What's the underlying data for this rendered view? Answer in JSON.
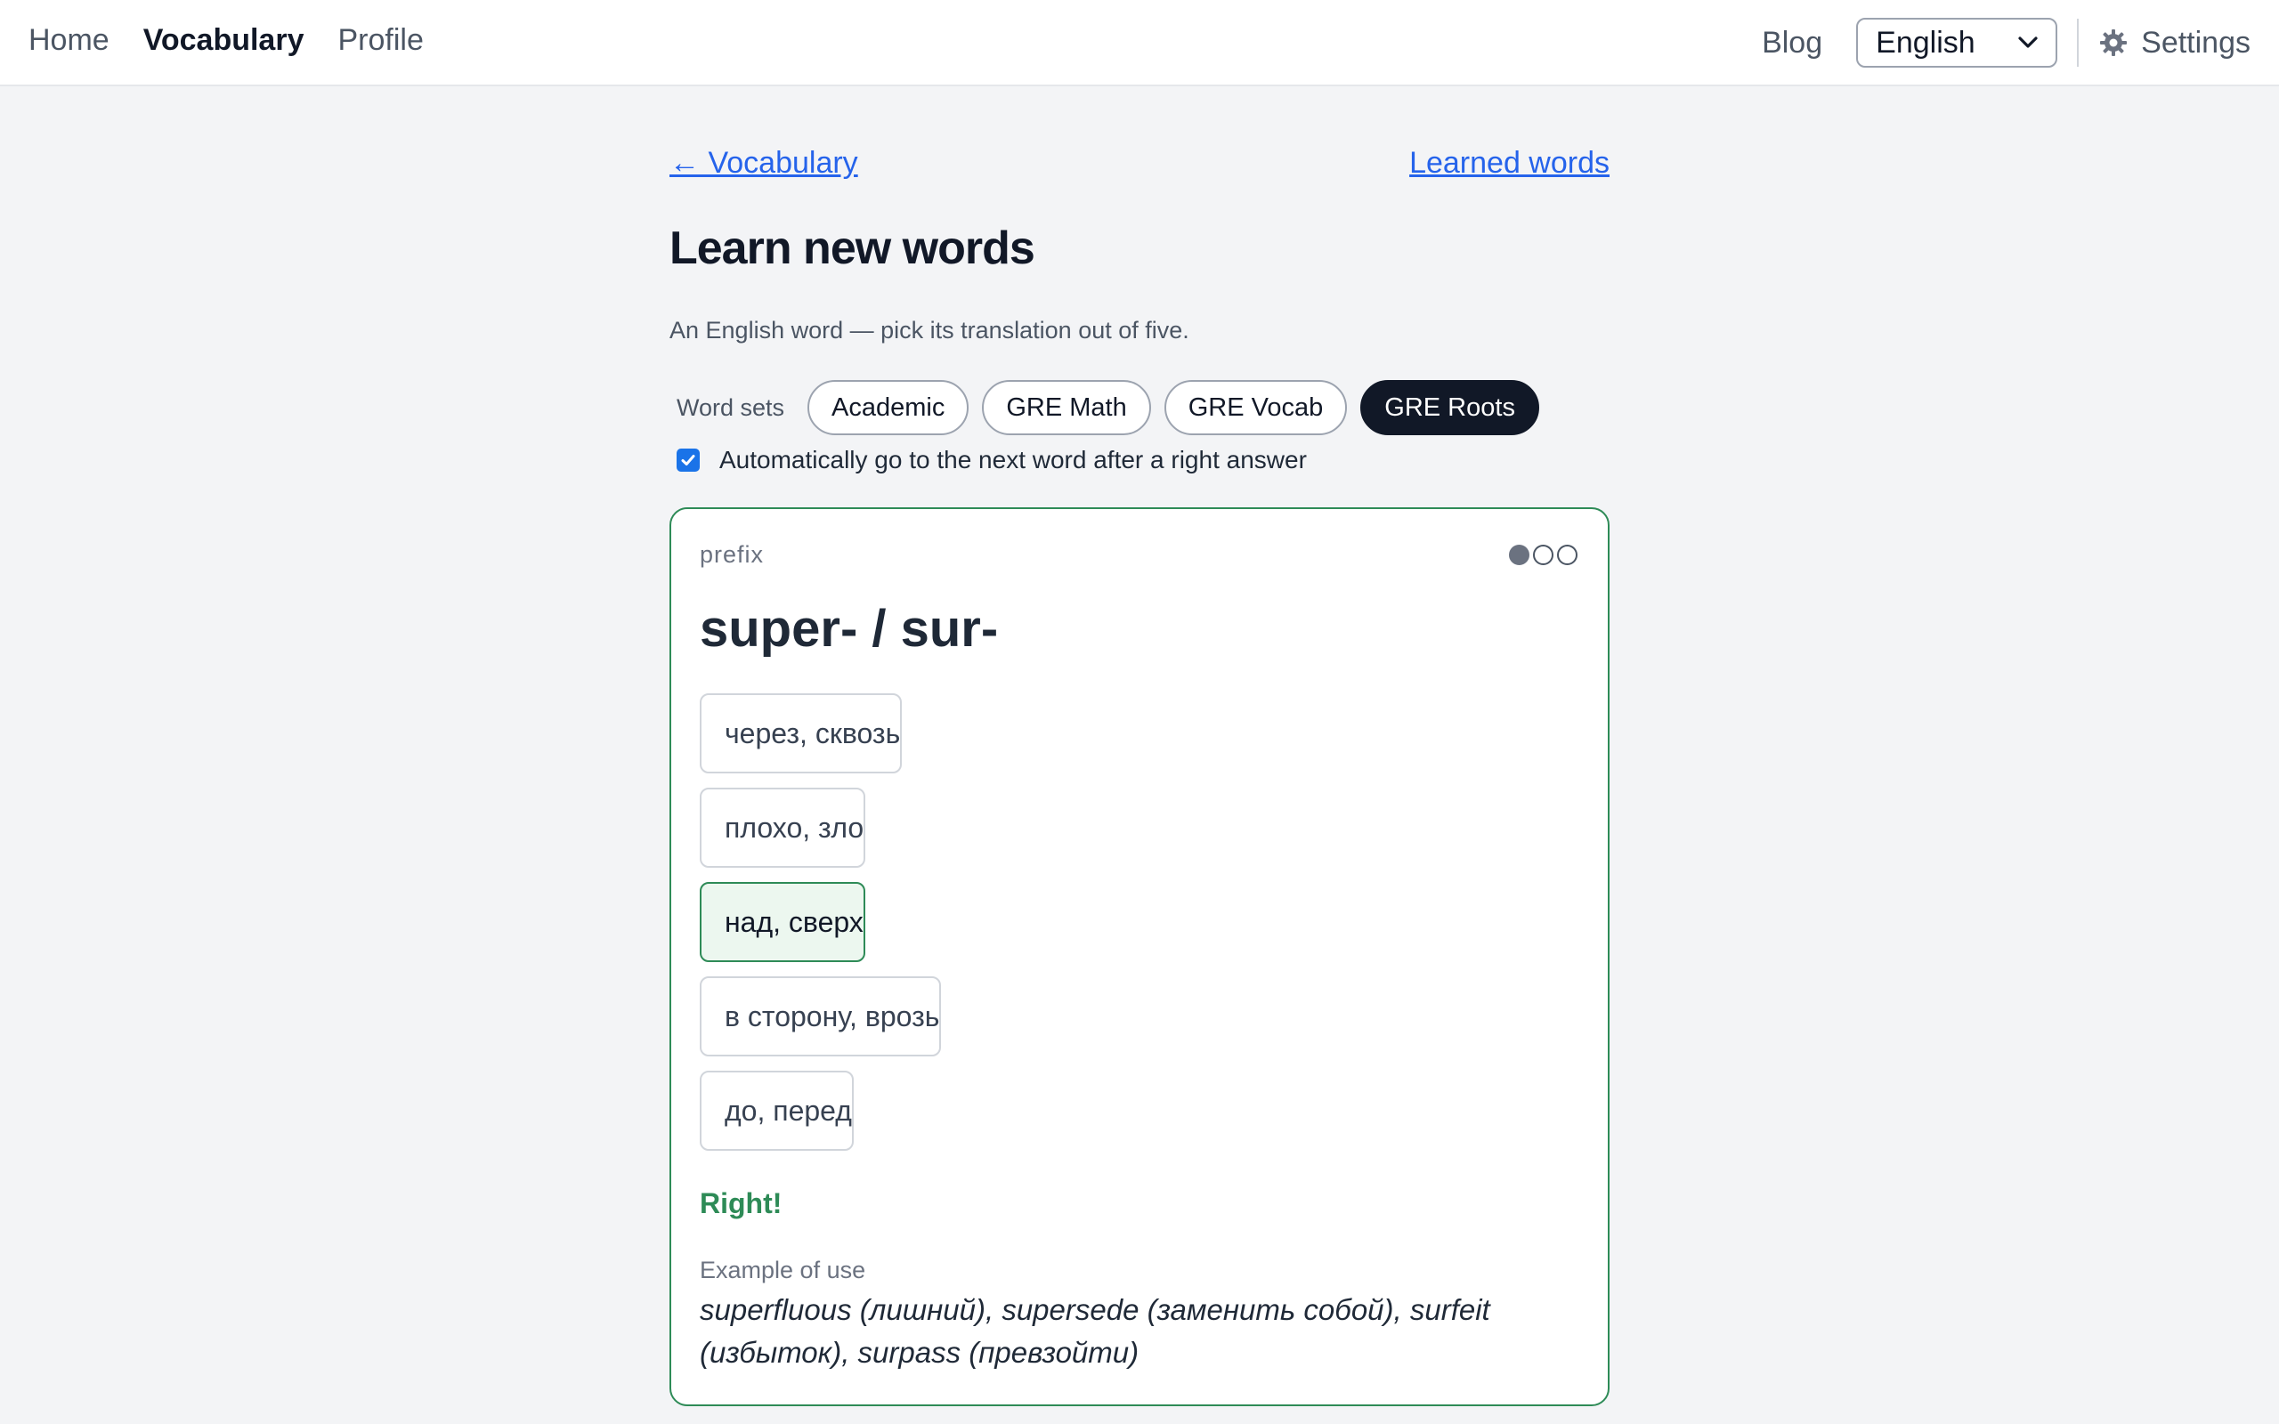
{
  "nav": {
    "home": "Home",
    "vocabulary": "Vocabulary",
    "profile": "Profile",
    "blog": "Blog",
    "language_selected": "English",
    "settings": "Settings"
  },
  "crumbs": {
    "back": "← Vocabulary",
    "learned": "Learned words"
  },
  "page": {
    "title": "Learn new words",
    "subtitle": "An English word — pick its translation out of five."
  },
  "word_sets": {
    "label": "Word sets",
    "items": [
      "Academic",
      "GRE Math",
      "GRE Vocab",
      "GRE Roots"
    ],
    "active": "GRE Roots"
  },
  "auto_next": {
    "label": "Automatically go to the next word after a right answer",
    "checked": true
  },
  "card": {
    "part_of_speech": "prefix",
    "progress": {
      "filled": 1,
      "total": 3
    },
    "word": "super- / sur-",
    "options": [
      "через, сквозь",
      "плохо, зло",
      "над, сверх",
      "в сторону, врозь",
      "до, перед"
    ],
    "correct_index": 2,
    "result": "Right!",
    "example_label": "Example of use",
    "example_text": "superfluous (лишний), supersede (заменить собой), surfeit (избыток), surpass (превзойти)"
  },
  "colors": {
    "accent_green": "#2e8b57",
    "link_blue": "#2563eb",
    "chip_active": "#111827",
    "checkbox_blue": "#1a73e8"
  }
}
